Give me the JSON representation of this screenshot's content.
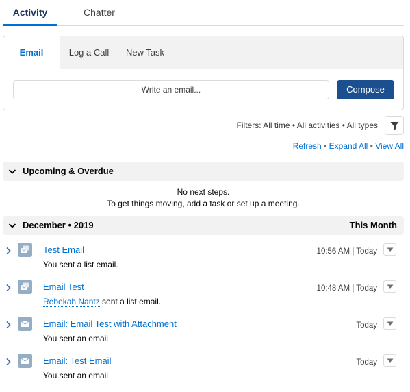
{
  "top_tabs": [
    {
      "label": "Activity",
      "active": true
    },
    {
      "label": "Chatter",
      "active": false
    }
  ],
  "composer": {
    "tabs": [
      {
        "label": "Email",
        "active": true
      },
      {
        "label": "Log a Call",
        "active": false
      },
      {
        "label": "New Task",
        "active": false
      }
    ],
    "input_placeholder": "Write an email...",
    "compose_label": "Compose"
  },
  "filters": {
    "text": "Filters: All time • All activities • All types",
    "refresh": "Refresh",
    "expand_all": "Expand All",
    "view_all": "View All",
    "separator": " • "
  },
  "upcoming": {
    "title": "Upcoming & Overdue",
    "empty_line1": "No next steps.",
    "empty_line2": "To get things moving, add a task or set up a meeting."
  },
  "month": {
    "title": "December • 2019",
    "right": "This Month"
  },
  "items": [
    {
      "icon": "list-email-icon",
      "subject": "Test Email",
      "desc_prefix": "",
      "person": "",
      "desc": "You sent a list email.",
      "time": "10:56 AM | Today"
    },
    {
      "icon": "list-email-icon",
      "subject": "Email Test",
      "desc_prefix": "",
      "person": "Rebekah Nantz",
      "desc": " sent a list email.",
      "time": "10:48 AM | Today"
    },
    {
      "icon": "email-icon",
      "subject": "Email: Email Test with Attachment",
      "desc_prefix": "",
      "person": "",
      "desc": "You sent an email",
      "time": "Today"
    },
    {
      "icon": "email-icon",
      "subject": "Email: Test Email",
      "desc_prefix": "",
      "person": "",
      "desc": "You sent an email",
      "time": "Today"
    }
  ],
  "colors": {
    "accent": "#0070d2",
    "compose_button": "#1b4f8f",
    "icon_bg": "#95aec5"
  }
}
